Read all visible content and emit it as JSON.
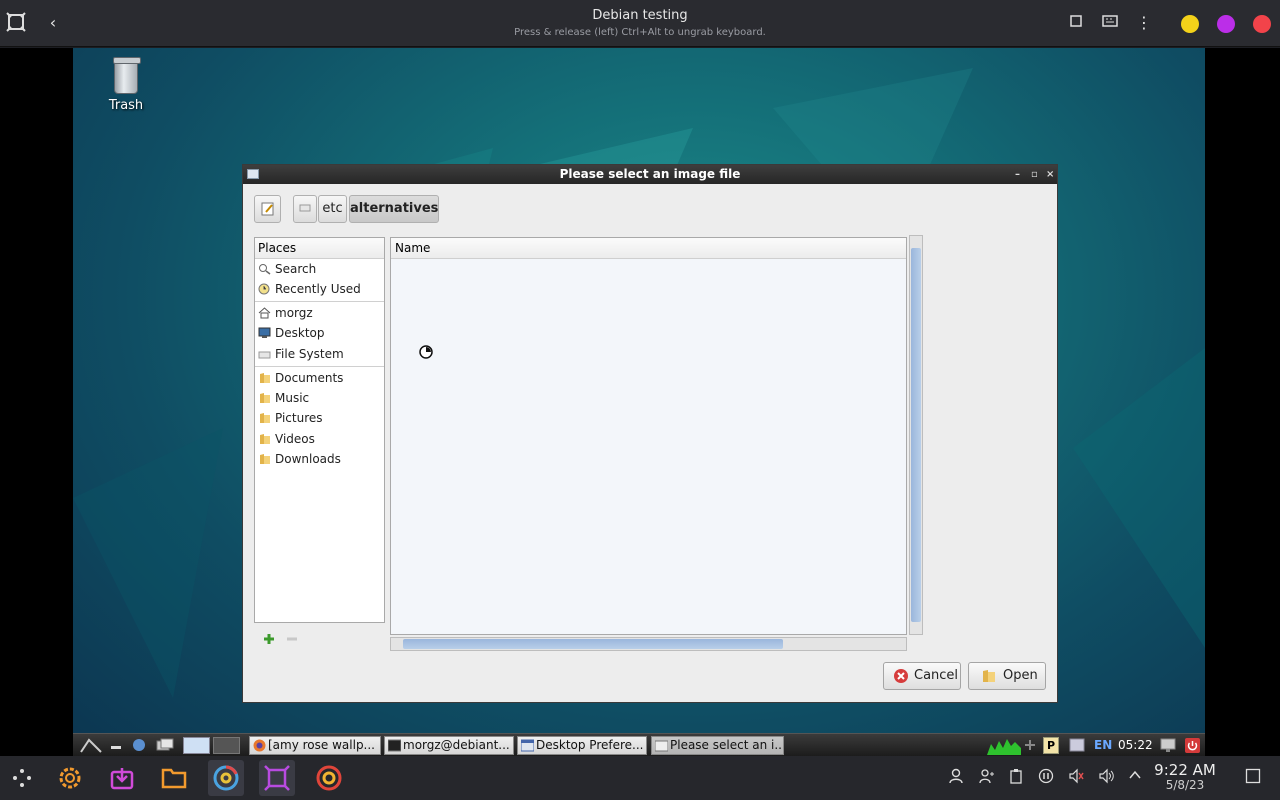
{
  "host": {
    "title": "Debian testing",
    "subtitle": "Press & release (left) Ctrl+Alt to ungrab keyboard.",
    "dots": [
      "#f4d21a",
      "#bb2ee8",
      "#f2434a"
    ],
    "clock_time": "9:22 AM",
    "clock_date": "5/8/23"
  },
  "desktop": {
    "trash_label": "Trash"
  },
  "dialog": {
    "title": "Please select an image file",
    "path": [
      "etc",
      "alternatives"
    ],
    "places_header": "Places",
    "places_group1": [
      "Search",
      "Recently Used"
    ],
    "places_group2": [
      "morgz",
      "Desktop",
      "File System"
    ],
    "places_group3": [
      "Documents",
      "Music",
      "Pictures",
      "Videos",
      "Downloads"
    ],
    "name_header": "Name",
    "cancel_label": "Cancel",
    "open_label": "Open"
  },
  "guest_taskbar": {
    "tasks": [
      "[amy rose wallp...",
      "morgz@debiant...",
      "Desktop Prefere...",
      "Please select an i..."
    ],
    "lang": "EN",
    "time": "05:22"
  }
}
